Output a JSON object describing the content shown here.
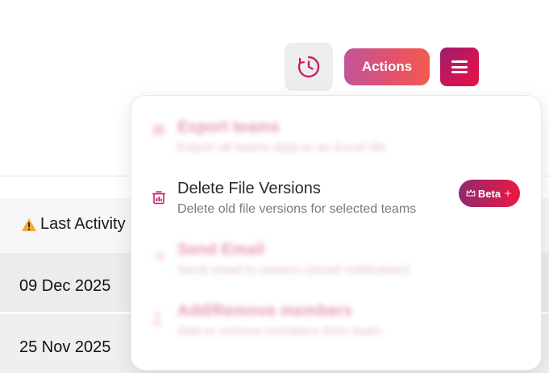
{
  "toolbar": {
    "actions_label": "Actions"
  },
  "table": {
    "header": {
      "last_activity": "Last Activity"
    },
    "rows": [
      {
        "last_activity": "09 Dec 2025"
      },
      {
        "last_activity": "25 Nov 2025"
      }
    ]
  },
  "menu": {
    "items": [
      {
        "title": "Export teams",
        "description": "Export all teams data to an Excel file"
      },
      {
        "title": "Delete File Versions",
        "description": "Delete old file versions for selected teams",
        "badge": "Beta"
      },
      {
        "title": "Send Email",
        "description": "Send email to owners (email notification)"
      },
      {
        "title": "Add/Remove members",
        "description": "Add or remove members from team"
      }
    ]
  },
  "colors": {
    "accent_pink": "#c8206b",
    "accent_red": "#e8103f",
    "actions_gradient_start": "#c2559a",
    "actions_gradient_end": "#f25a4e"
  }
}
